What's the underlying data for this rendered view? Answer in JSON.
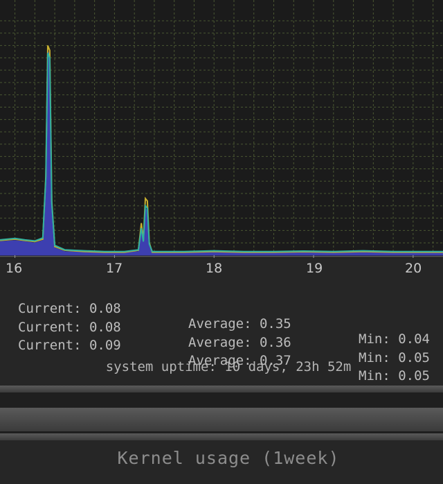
{
  "chart_data": {
    "type": "area",
    "x_tick_labels": [
      "16",
      "17",
      "18",
      "19",
      "20"
    ],
    "xlim": [
      15.85,
      20.3
    ],
    "ylim": [
      0,
      9.5
    ],
    "grid": true,
    "series": [
      {
        "color": "#3d3fb0",
        "fill": true,
        "x": [
          15.85,
          16.0,
          16.1,
          16.2,
          16.28,
          16.31,
          16.33,
          16.35,
          16.37,
          16.4,
          16.5,
          16.7,
          16.9,
          17.1,
          17.24,
          17.27,
          17.29,
          17.31,
          17.33,
          17.35,
          17.38,
          17.5,
          17.7,
          18.0,
          18.3,
          18.6,
          18.9,
          19.2,
          19.5,
          19.8,
          20.1,
          20.3
        ],
        "y": [
          0.55,
          0.6,
          0.55,
          0.5,
          0.6,
          3.0,
          8.3,
          8.1,
          2.0,
          0.3,
          0.15,
          0.12,
          0.1,
          0.1,
          0.15,
          1.0,
          0.5,
          1.9,
          1.8,
          0.4,
          0.1,
          0.1,
          0.1,
          0.12,
          0.1,
          0.1,
          0.11,
          0.1,
          0.12,
          0.1,
          0.1,
          0.1
        ]
      },
      {
        "color": "#c8b030",
        "fill": false,
        "x": [
          15.85,
          16.0,
          16.1,
          16.2,
          16.28,
          16.31,
          16.33,
          16.35,
          16.37,
          16.4,
          16.5,
          16.7,
          16.9,
          17.1,
          17.24,
          17.27,
          17.29,
          17.31,
          17.33,
          17.35,
          17.38,
          17.5,
          17.7,
          18.0,
          18.3,
          18.6,
          18.9,
          19.2,
          19.5,
          19.8,
          20.1,
          20.3
        ],
        "y": [
          0.6,
          0.65,
          0.6,
          0.55,
          0.65,
          3.2,
          8.5,
          8.3,
          2.2,
          0.35,
          0.2,
          0.15,
          0.12,
          0.12,
          0.2,
          1.3,
          0.6,
          2.3,
          2.2,
          0.5,
          0.12,
          0.12,
          0.12,
          0.15,
          0.12,
          0.12,
          0.14,
          0.12,
          0.15,
          0.12,
          0.12,
          0.12
        ]
      },
      {
        "color": "#2fb0a0",
        "fill": false,
        "x": [
          15.85,
          16.0,
          16.1,
          16.2,
          16.28,
          16.31,
          16.33,
          16.35,
          16.37,
          16.4,
          16.5,
          16.7,
          16.9,
          17.1,
          17.24,
          17.27,
          17.29,
          17.31,
          17.33,
          17.35,
          17.38,
          17.5,
          17.7,
          18.0,
          18.3,
          18.6,
          18.9,
          19.2,
          19.5,
          19.8,
          20.1,
          20.3
        ],
        "y": [
          0.62,
          0.68,
          0.62,
          0.58,
          0.7,
          3.1,
          8.2,
          8.0,
          2.1,
          0.4,
          0.22,
          0.18,
          0.15,
          0.15,
          0.22,
          1.1,
          0.55,
          2.0,
          1.9,
          0.45,
          0.15,
          0.15,
          0.15,
          0.18,
          0.15,
          0.15,
          0.17,
          0.15,
          0.18,
          0.15,
          0.15,
          0.15
        ]
      }
    ]
  },
  "stats": [
    {
      "current": "Current: 0.08",
      "average": "Average: 0.35",
      "min": "Min: 0.04"
    },
    {
      "current": "Current: 0.08",
      "average": "Average: 0.36",
      "min": "Min: 0.05"
    },
    {
      "current": "Current: 0.09",
      "average": "Average: 0.37",
      "min": "Min: 0.05"
    }
  ],
  "uptime": "system uptime: 10 days, 23h 52m",
  "next_panel_title": "Kernel usage  (1week)"
}
